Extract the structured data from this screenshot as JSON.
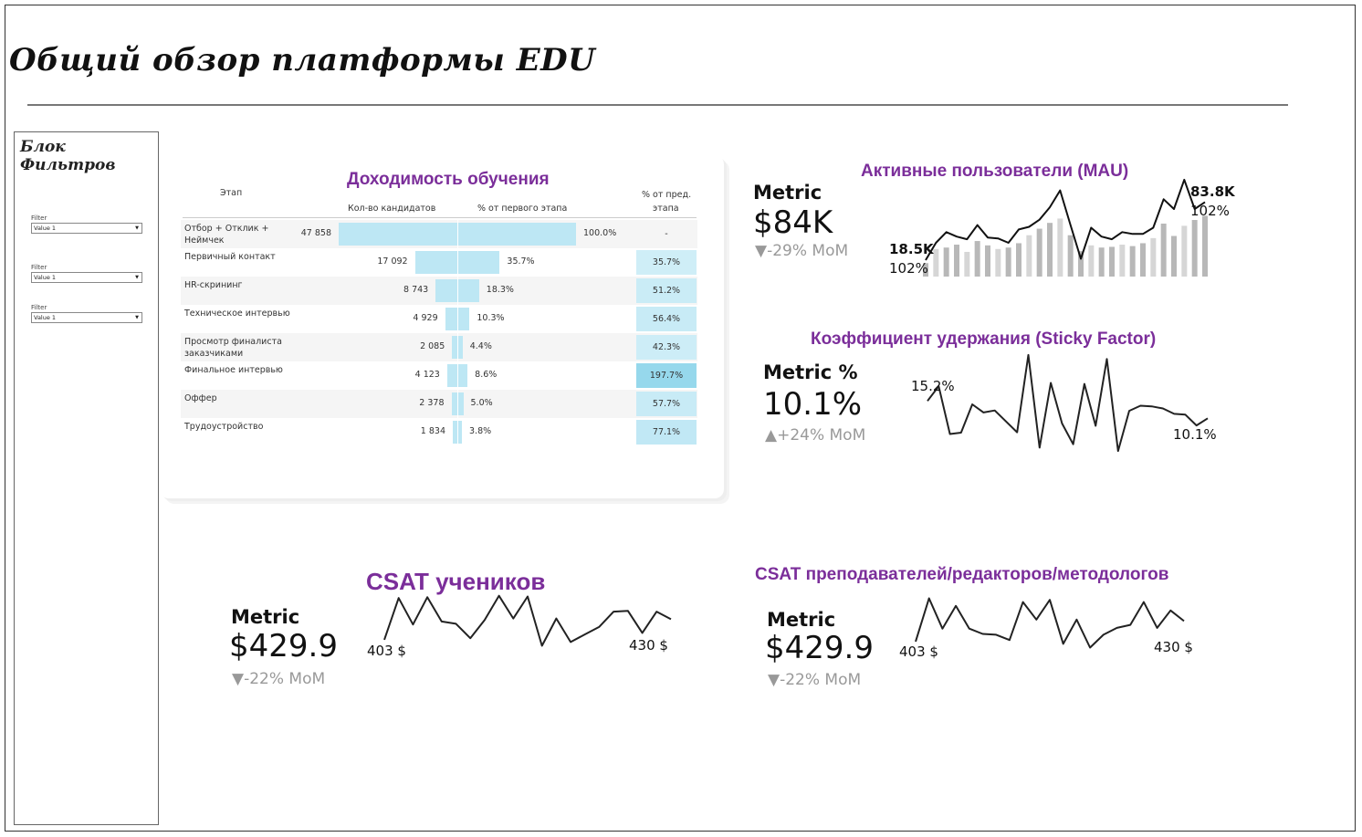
{
  "page": {
    "title": "Общий обзор платформы EDU"
  },
  "filters": {
    "title": "Блок Фильтров",
    "items": [
      {
        "label": "Filter",
        "value": "Value 1"
      },
      {
        "label": "Filter",
        "value": "Value 1"
      },
      {
        "label": "Filter",
        "value": "Value 1"
      }
    ]
  },
  "funnel": {
    "title": "Доходимость обучения",
    "headers": {
      "stage": "Этап",
      "count": "Кол-во кандидатов",
      "pct_first": "% от первого этапа",
      "pct_prev_1": "% от пред.",
      "pct_prev_2": "этапа"
    },
    "rows": [
      {
        "stage": "Отбор + Отклик + Неймчек",
        "count": "47 858",
        "pct_first": "100.0%",
        "pct_first_value": 100.0,
        "pct_prev": "-",
        "pct_prev_value": 0
      },
      {
        "stage": "Первичный контакт",
        "count": "17 092",
        "pct_first": "35.7%",
        "pct_first_value": 35.7,
        "pct_prev": "35.7%",
        "pct_prev_value": 35.7
      },
      {
        "stage": "HR-скрининг",
        "count": "8 743",
        "pct_first": "18.3%",
        "pct_first_value": 18.3,
        "pct_prev": "51.2%",
        "pct_prev_value": 51.2
      },
      {
        "stage": "Техническое интервью",
        "count": "4 929",
        "pct_first": "10.3%",
        "pct_first_value": 10.3,
        "pct_prev": "56.4%",
        "pct_prev_value": 56.4
      },
      {
        "stage": "Просмотр финалиста заказчиками",
        "count": "2 085",
        "pct_first": "4.4%",
        "pct_first_value": 4.4,
        "pct_prev": "42.3%",
        "pct_prev_value": 42.3
      },
      {
        "stage": "Финальное интервью",
        "count": "4 123",
        "pct_first": "8.6%",
        "pct_first_value": 8.6,
        "pct_prev": "197.7%",
        "pct_prev_value": 197.7
      },
      {
        "stage": "Оффер",
        "count": "2 378",
        "pct_first": "5.0%",
        "pct_first_value": 5.0,
        "pct_prev": "57.7%",
        "pct_prev_value": 57.7
      },
      {
        "stage": "Трудоустройство",
        "count": "1 834",
        "pct_first": "3.8%",
        "pct_first_value": 3.8,
        "pct_prev": "77.1%",
        "pct_prev_value": 77.1
      }
    ]
  },
  "mau": {
    "title": "Активные пользователи (MAU)",
    "metric_label": "Metric",
    "metric_value": "$84K",
    "metric_delta": "▼-29% MoM",
    "start_value": "18.5K",
    "start_pct": "102%",
    "end_value": "83.8K",
    "end_pct": "102%"
  },
  "sticky": {
    "title": "Коэффициент удержания (Sticky Factor)",
    "metric_label": "Metric %",
    "metric_value": "10.1%",
    "metric_delta": "▲+24% MoM",
    "start_label": "15.2%",
    "end_label": "10.1%"
  },
  "csat_students": {
    "title": "CSAT учеников",
    "metric_label": "Metric",
    "metric_value": "$429.9",
    "metric_delta": "▼-22% MoM",
    "start_label": "403 $",
    "end_label": "430 $"
  },
  "csat_teachers": {
    "title": "CSAT преподавателей/редакторов/методологов",
    "metric_label": "Metric",
    "metric_value": "$429.9",
    "metric_delta": "▼-22% MoM",
    "start_label": "403 $",
    "end_label": "430 $"
  },
  "chart_data": [
    {
      "type": "bar",
      "name_ref": "mau",
      "values": [
        18.5,
        38,
        40,
        44,
        34,
        49,
        43,
        38,
        40,
        46,
        57,
        66,
        74,
        80,
        57,
        35,
        43,
        40,
        41,
        44,
        42,
        46,
        53,
        73,
        56,
        70,
        78,
        83.8
      ],
      "line": [
        18.5,
        38,
        50,
        45,
        42,
        58,
        44,
        43,
        38,
        53,
        56,
        64,
        78,
        97,
        58,
        20,
        55,
        45,
        42,
        50,
        48,
        48,
        55,
        87,
        76,
        109,
        76,
        83.8
      ]
    },
    {
      "type": "line",
      "name_ref": "sticky",
      "values": [
        15.2,
        19.5,
        5.5,
        5.9,
        14.2,
        11.8,
        12.4,
        9.2,
        6.0,
        28.7,
        1.5,
        20.5,
        8.6,
        2.5,
        20.2,
        7.9,
        27.5,
        0.5,
        12.3,
        13.8,
        13.6,
        13.0,
        11.4,
        11.2,
        8.0,
        10.1
      ]
    },
    {
      "type": "line",
      "name_ref": "csat_students",
      "values": [
        403,
        458,
        423,
        459,
        427,
        424,
        405,
        429,
        461,
        431,
        460,
        395,
        431,
        400,
        410,
        420,
        440,
        441,
        412,
        440,
        430
      ]
    },
    {
      "type": "line",
      "name_ref": "csat_teachers",
      "values": [
        403,
        460,
        420,
        450,
        420,
        413,
        412,
        405,
        455,
        432,
        458,
        400,
        432,
        395,
        412,
        421,
        425,
        455,
        421,
        444,
        430
      ]
    }
  ]
}
